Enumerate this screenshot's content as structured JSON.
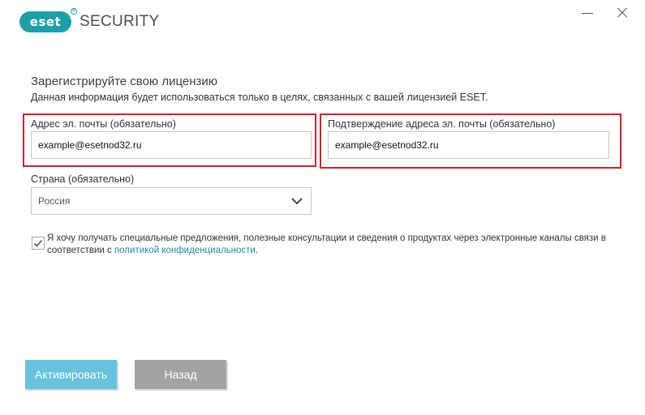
{
  "app": {
    "logo_text": "eset",
    "product_name": "SECURITY",
    "brand_color": "#1ba0a7"
  },
  "window_controls": {
    "minimize_icon": "minimize-icon",
    "close_icon": "close-icon"
  },
  "form": {
    "heading": "Зарегистрируйте свою лицензию",
    "subheading": "Данная информация будет использоваться только в целях, связанных с вашей лицензией ESET.",
    "email": {
      "label": "Адрес эл. почты (обязательно)",
      "value": "example@esetnod32.ru"
    },
    "email_confirm": {
      "label": "Подтверждение адреса эл. почты (обязательно)",
      "value": "example@esetnod32.ru"
    },
    "country": {
      "label": "Страна (обязательно)",
      "selected": "Россия"
    },
    "consent": {
      "checked": true,
      "text_before": "Я хочу получать специальные предложения, полезные консультации и сведения о продуктах через электронные каналы связи в соответствии с ",
      "link_text": "политикой конфиденциальности",
      "text_after": "."
    },
    "highlight_color": "#d0202e"
  },
  "buttons": {
    "activate_label": "Активировать",
    "back_label": "Назад",
    "activate_color": "#67c2dc",
    "back_color": "#a3a3a3"
  }
}
